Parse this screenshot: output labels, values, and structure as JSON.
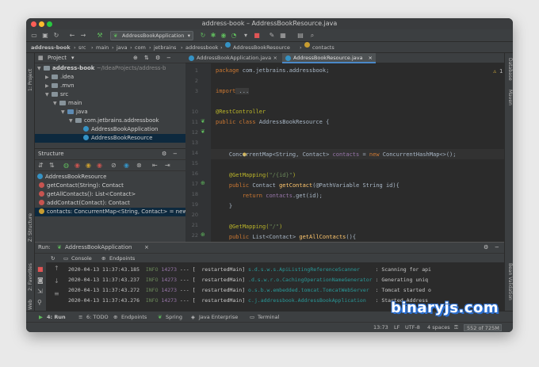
{
  "window": {
    "title": "address-book – AddressBookResource.java"
  },
  "toolbar": {
    "run_config": "AddressBookApplication"
  },
  "breadcrumb": [
    "address-book",
    "src",
    "main",
    "java",
    "com",
    "jetbrains",
    "addressbook",
    "AddressBookResource",
    "contacts"
  ],
  "left_strip": {
    "project_tab": "1: Project",
    "structure_tab": "Z: Structure",
    "favorites_tab": "2: Favorites",
    "web_tab": "Web"
  },
  "right_strip": {
    "database_tab": "Database",
    "maven_tab": "Maven",
    "bean_tab": "Bean Validation"
  },
  "project": {
    "title": "Project",
    "tree": [
      {
        "label": "address-book",
        "hint": "~/IdeaProjects/address-b",
        "type": "folder"
      },
      {
        "label": ".idea",
        "type": "folder"
      },
      {
        "label": ".mvn",
        "type": "folder"
      },
      {
        "label": "src",
        "type": "folder"
      },
      {
        "label": "main",
        "type": "folder"
      },
      {
        "label": "java",
        "type": "folder-blue"
      },
      {
        "label": "com.jetbrains.addressbook",
        "type": "folder"
      },
      {
        "label": "AddressBookApplication",
        "type": "class"
      },
      {
        "label": "AddressBookResource",
        "type": "class"
      }
    ]
  },
  "structure": {
    "title": "Structure",
    "items": [
      {
        "label": "AddressBookResource",
        "type": "class"
      },
      {
        "label": "getContact(String): Contact",
        "type": "method"
      },
      {
        "label": "getAllContacts(): List<Contact>",
        "type": "method"
      },
      {
        "label": "addContact(Contact): Contact",
        "type": "method"
      },
      {
        "label": "contacts: ConcurrentMap<String, Contact> = new",
        "type": "field"
      }
    ]
  },
  "editor": {
    "tabs": [
      "AddressBookApplication.java",
      "AddressBookResource.java"
    ],
    "warning_count": "1",
    "line_numbers": [
      "1",
      "2",
      "3",
      "",
      "10",
      "11",
      "12",
      "13",
      "14",
      "15",
      "16",
      "17",
      "18",
      "19",
      "20",
      "21",
      "22",
      "23"
    ]
  },
  "code_lines": [
    {
      "t1": "package",
      "t2": " com.jetbrains.addressbook;"
    },
    {
      "t1": "",
      "t2": ""
    },
    {
      "t1": "import",
      "t2": " ..."
    },
    {
      "t1": "",
      "t2": ""
    },
    {
      "t1": "@RestController",
      "t2": ""
    },
    {
      "t1": "public class",
      "t2": " AddressBookResource {"
    },
    {
      "t1": "",
      "t2": ""
    },
    {
      "t1": "    ConcurrentMap<String, Contact> ",
      "t2": "contacts",
      "t3": " = ",
      "t4": "new",
      "t5": " ConcurrentHashMap<>();"
    },
    {
      "t1": "",
      "t2": ""
    },
    {
      "t1": "    @GetMapping(",
      "t2": "\"/{id}\"",
      "t3": ")"
    },
    {
      "t1": "    public",
      "t2": " Contact ",
      "t3": "getContact",
      "t4": "(@PathVariable String id){"
    },
    {
      "t1": "        return",
      "t2": " contacts",
      "t3": ".get(id);"
    },
    {
      "t1": "    }",
      "t2": ""
    },
    {
      "t1": "",
      "t2": ""
    },
    {
      "t1": "    @GetMapping(",
      "t2": "\"/\"",
      "t3": ")"
    },
    {
      "t1": "    public",
      "t2": " List<Contact> ",
      "t3": "getAllContacts",
      "t4": "(){"
    },
    {
      "t1": "        return new",
      "t2": " ArrayList<Contact>(",
      "t3": "contacts",
      "t4": ".values());"
    },
    {
      "t1": "    }",
      "t2": ""
    }
  ],
  "run": {
    "label": "Run:",
    "config": "AddressBookApplication",
    "tabs": [
      "Console",
      "Endpoints"
    ],
    "logs": [
      {
        "time": "2020-04-13 11:37:43.185",
        "level": "INFO",
        "pid": "14273",
        "sep": "--- [",
        "thread": "  restartedMain]",
        "logger": "s.d.s.w.s.ApiListingReferenceScanner",
        "msg": ": Scanning for api"
      },
      {
        "time": "2020-04-13 11:37:43.237",
        "level": "INFO",
        "pid": "14273",
        "sep": "--- [",
        "thread": "  restartedMain]",
        "logger": ".d.s.w.r.o.CachingOperationNameGenerator",
        "msg": ": Generating uniq"
      },
      {
        "time": "2020-04-13 11:37:43.272",
        "level": "INFO",
        "pid": "14273",
        "sep": "--- [",
        "thread": "  restartedMain]",
        "logger": "o.s.b.w.embedded.tomcat.TomcatWebServer",
        "msg": ": Tomcat started o"
      },
      {
        "time": "2020-04-13 11:37:43.276",
        "level": "INFO",
        "pid": "14273",
        "sep": "--- [",
        "thread": "  restartedMain]",
        "logger": "c.j.addressbook.AddressBookApplication",
        "msg": ": Started Address"
      }
    ]
  },
  "bottom_tabs": [
    "4: Run",
    "6: TODO",
    "Endpoints",
    "Spring",
    "Java Enterprise",
    "Terminal"
  ],
  "status": {
    "position": "13:73",
    "line_sep": "LF",
    "encoding": "UTF-8",
    "indent": "4 spaces",
    "memory": "552 of 725M"
  },
  "watermark": "binaryjs.com",
  "colors": {
    "accent": "#4a88c7",
    "keyword": "#cc7832",
    "annotation": "#bbb529",
    "info": "#6a8759"
  }
}
